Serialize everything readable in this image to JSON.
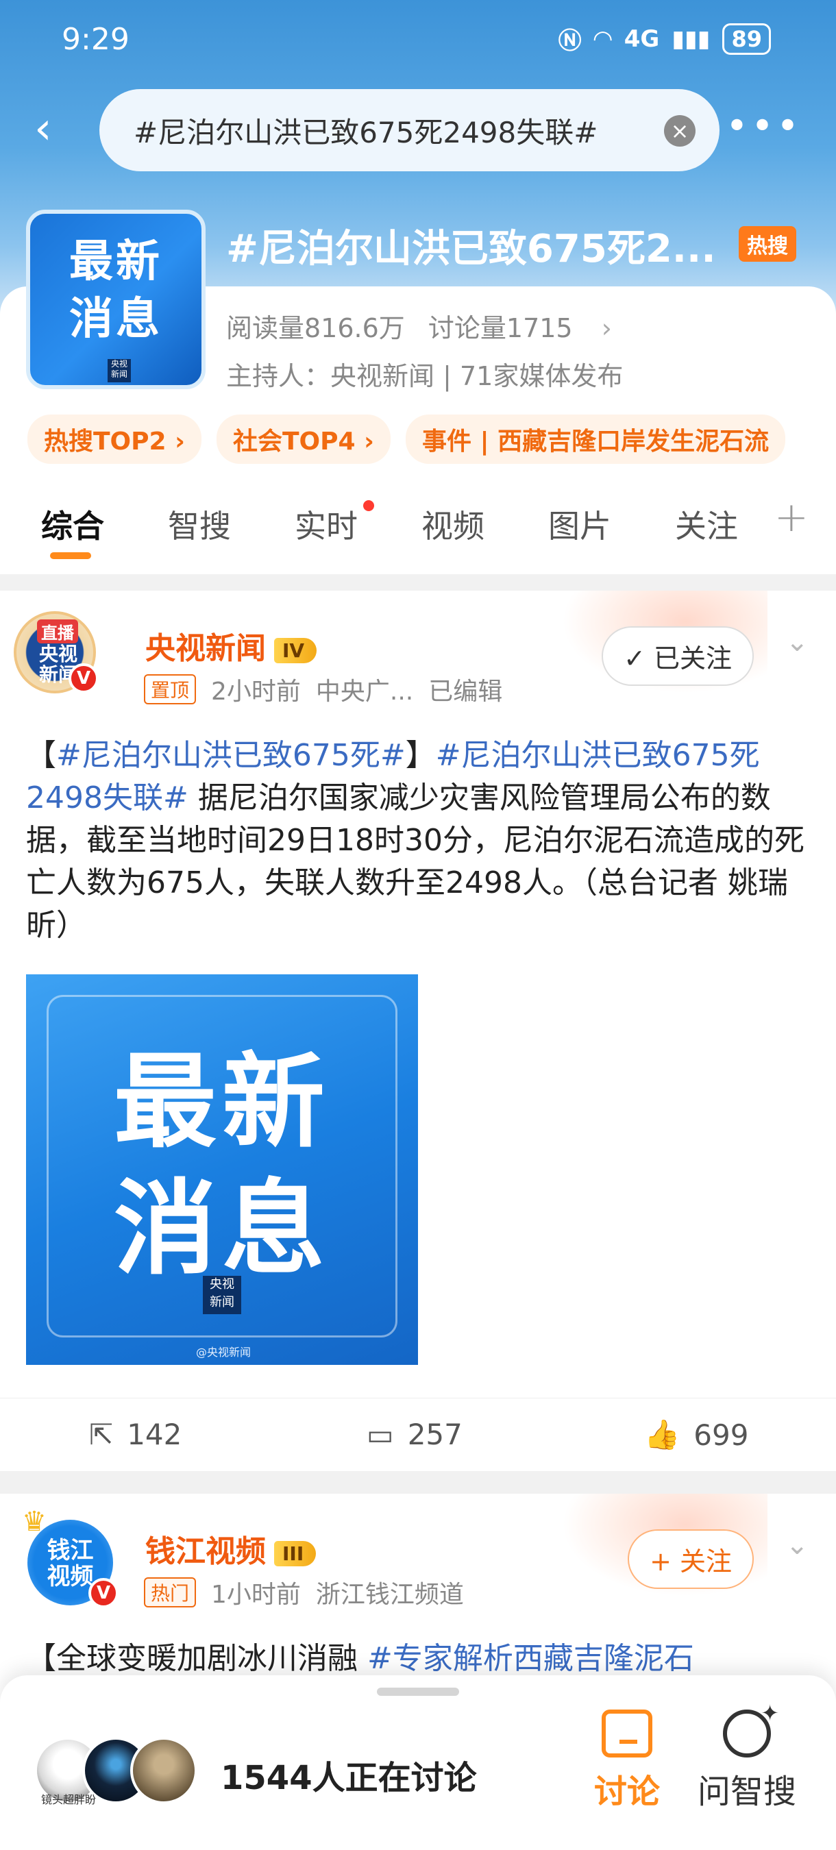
{
  "status": {
    "time": "9:29",
    "signal": "4G",
    "battery": "89"
  },
  "search": {
    "query": "#尼泊尔山洪已致675死2498失联#"
  },
  "topic": {
    "title": "#尼泊尔山洪已致675死2...",
    "hot_label": "热搜",
    "thumb_text": "最新\n消息",
    "thumb_logo": "央视新闻",
    "reads": "阅读量816.6万",
    "discussions": "讨论量1715",
    "host": "主持人：央视新闻 | 71家媒体发布",
    "tags": [
      "热搜TOP2 ›",
      "社会TOP4 ›",
      "事件 | 西藏吉隆口岸发生泥石流"
    ]
  },
  "tabs": [
    "综合",
    "智搜",
    "实时",
    "视频",
    "图片",
    "关注"
  ],
  "post1": {
    "author": "央视新闻",
    "level": "IV",
    "avatar_live": "直播",
    "avatar_text": "央视新闻",
    "pinned": "置顶",
    "time": "2小时前",
    "source": "中央广...",
    "edited": "已编辑",
    "follow_label": "已关注",
    "body_prefix": "【",
    "tag1": "#尼泊尔山洪已致675死#",
    "body_mid": "】",
    "tag2": "#尼泊尔山洪已致675死2498失联#",
    "body_text": " 据尼泊尔国家减少灾害风险管理局公布的数据，截至当地时间29日18时30分，尼泊尔泥石流造成的死亡人数为675人，失联人数升至2498人。（总台记者 姚瑞昕）",
    "image_text": "最新\n消息",
    "image_logo": "央视新闻",
    "image_watermark": "@央视新闻",
    "reposts": "142",
    "comments": "257",
    "likes": "699"
  },
  "post2": {
    "author": "钱江视频",
    "level": "III",
    "avatar_text": "钱江视频",
    "hot": "热门",
    "time": "1小时前",
    "source": "浙江钱江频道",
    "follow_label": "+ 关注",
    "body_prefix": "【全球变暖加剧冰川消融 ",
    "tag": "#专家解析西藏吉隆泥石"
  },
  "bottom": {
    "user1_caption": "镜头超胖盼",
    "discuss_count": "1544人正在讨论",
    "discuss_label": "讨论",
    "ai_label": "问智搜"
  }
}
